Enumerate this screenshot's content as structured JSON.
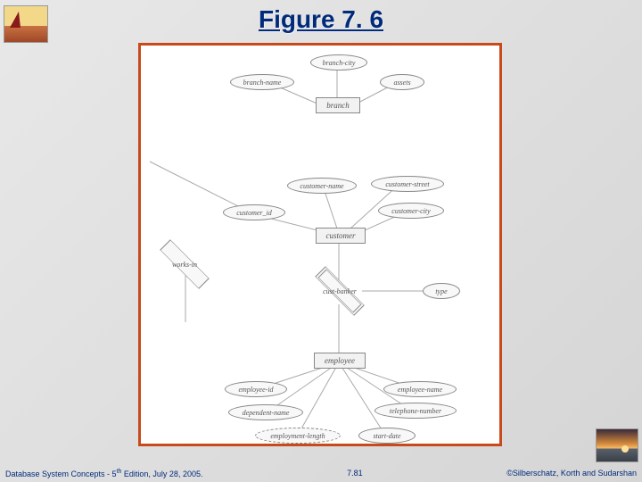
{
  "title": "Figure 7. 6",
  "footer": {
    "left_a": "Database System Concepts - 5",
    "left_sup": "th",
    "left_b": " Edition, July 28, 2005.",
    "center": "7.81",
    "right": "©Silberschatz, Korth and Sudarshan"
  },
  "er": {
    "attributes": {
      "branch_city": "branch-city",
      "branch_name": "branch-name",
      "assets": "assets",
      "customer_name": "customer-name",
      "customer_street": "customer-street",
      "customer_id": "customer_id",
      "customer_city": "customer-city",
      "employee_id": "employee-id",
      "employee_name": "employee-name",
      "dependent_name": "dependent-name",
      "telephone_number": "telephone-number",
      "employment_length": "employment-length",
      "start_date": "start-date",
      "type": "type"
    },
    "entities": {
      "branch": "branch",
      "customer": "customer",
      "employee": "employee"
    },
    "relationships": {
      "works_in": "works-in",
      "cust_banker": "cust-banker"
    }
  }
}
